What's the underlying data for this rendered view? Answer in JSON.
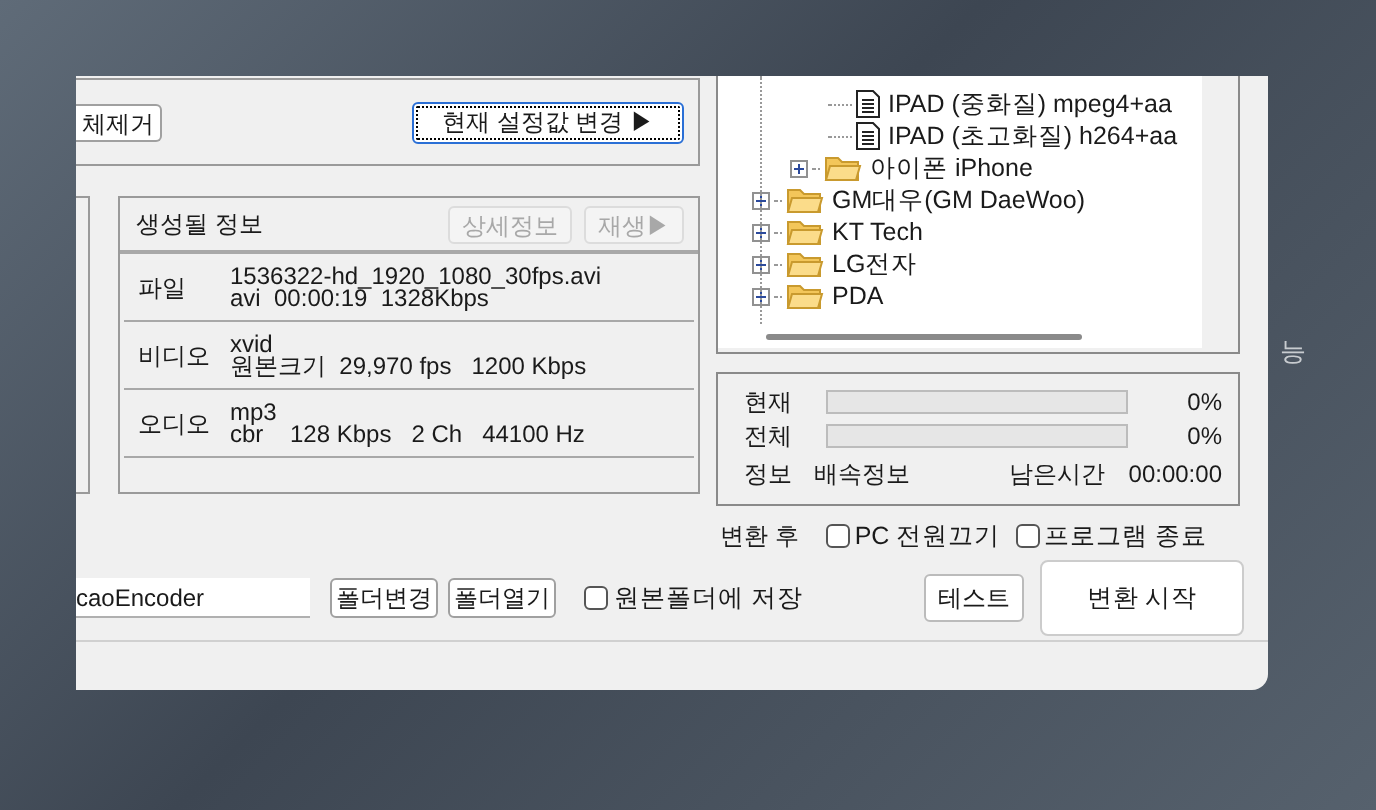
{
  "top_buttons": [
    {
      "label": "체제거",
      "focused": false
    },
    {
      "label": "현재 설정값 변경 ▶",
      "focused": true
    }
  ],
  "output_info": {
    "title": "생성될 정보",
    "buttons": [
      {
        "label": "상세정보",
        "disabled": true
      },
      {
        "label": "재생▶",
        "disabled": true
      }
    ],
    "rows": [
      {
        "label": "파일",
        "lines": [
          "1536322-hd_1920_1080_30fps.avi",
          "avi  00:00:19  1328Kbps"
        ]
      },
      {
        "label": "비디오",
        "lines": [
          "xvid",
          "원본크기  29,970 fps   1200 Kbps"
        ]
      },
      {
        "label": "오디오",
        "lines": [
          "mp3",
          "cbr    128 Kbps   2 Ch   44100 Hz"
        ]
      }
    ]
  },
  "preset_tree": [
    {
      "children": [
        {
          "children": [
            {
              "label": "IPAD (중화질) mpeg4+aa",
              "kind": "file"
            },
            {
              "label": "IPAD (초고화질) h264+aa",
              "kind": "file"
            }
          ]
        },
        {
          "label": "아이폰 iPhone",
          "kind": "folder",
          "expanded": false
        }
      ]
    },
    {
      "label": "GM대우(GM DaeWoo)",
      "kind": "folder",
      "expanded": false
    },
    {
      "label": "KT Tech",
      "kind": "folder",
      "expanded": false
    },
    {
      "label": "LG전자",
      "kind": "folder",
      "expanded": false
    },
    {
      "label": "PDA",
      "kind": "folder",
      "expanded": false
    }
  ],
  "progress": {
    "bars": [
      {
        "label": "현재",
        "level": 0,
        "reading": "0%"
      },
      {
        "label": "전체",
        "level": 0,
        "reading": "0%"
      }
    ],
    "info": {
      "label": "정보",
      "value": "배속정보",
      "remaining_label": "남은시간",
      "remaining": "00:00:00"
    }
  },
  "after_conversion": {
    "label": "변환 후",
    "options": [
      {
        "label": "PC 전원끄기",
        "checked": false
      },
      {
        "label": "프로그램 종료",
        "checked": false
      }
    ]
  },
  "output_folder": {
    "path": "caoEncoder",
    "buttons": [
      "폴더변경",
      "폴더열기"
    ],
    "save_to_source": {
      "label": "원본폴더에 저장",
      "checked": false
    }
  },
  "actions": [
    "테스트",
    "변환 시작"
  ],
  "background_text": "능"
}
